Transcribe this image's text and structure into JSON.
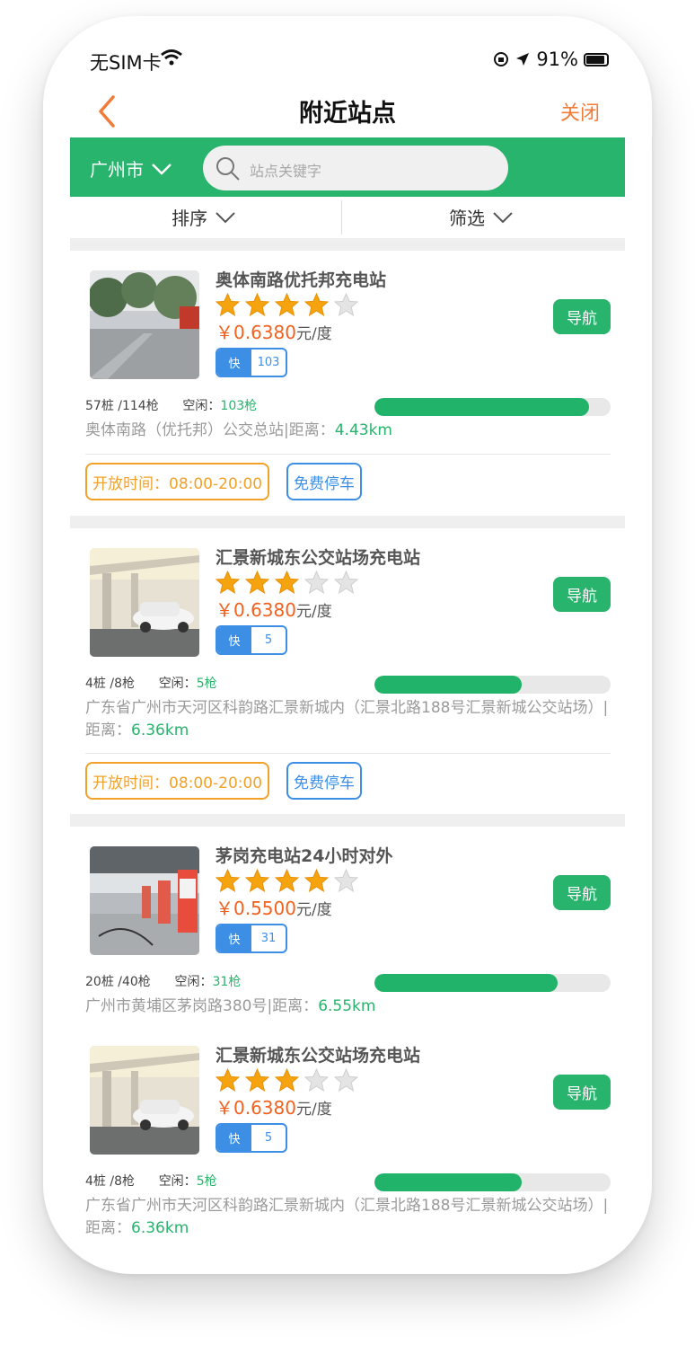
{
  "status_bar": {
    "carrier": "无SIM卡",
    "battery": "91%"
  },
  "nav": {
    "title": "附近站点",
    "close": "关闭"
  },
  "search": {
    "city": "广州市",
    "placeholder": "站点关键字"
  },
  "filters": {
    "sort": "排序",
    "filter": "筛选"
  },
  "colors": {
    "green": "#28b46c",
    "orange": "#f07c3a",
    "blue": "#3d8fe6",
    "price": "#f2611f",
    "star": "#f5a30e"
  },
  "stations": [
    {
      "name": "奥体南路优托邦充电站",
      "rating": 4,
      "price": "￥0.6380",
      "unit": "元/度",
      "tag": "快",
      "tag_count": "103",
      "nav": "导航",
      "piles": "57桩 /114枪",
      "idle_label": "空闲：",
      "idle_value": "103枪",
      "availability": 0.91,
      "address": "奥体南路（优托邦）公交总站|距离：",
      "distance": "4.43km",
      "open_hours": "开放时间：08:00-20:00",
      "parking": "免费停车",
      "image": "bus-station-photo"
    },
    {
      "name": "汇景新城东公交站场充电站",
      "rating": 3,
      "price": "￥0.6380",
      "unit": "元/度",
      "tag": "快",
      "tag_count": "5",
      "nav": "导航",
      "piles": "4桩 /8枪",
      "idle_label": "空闲：",
      "idle_value": "5枪",
      "availability": 0.625,
      "address": "广东省广州市天河区科韵路汇景新城内（汇景北路188号汇景新城公交站场）|距离：",
      "distance": "6.36km",
      "open_hours": "开放时间：08:00-20:00",
      "parking": "免费停车",
      "image": "car-charging-photo"
    },
    {
      "name": "茅岗充电站24小时对外",
      "rating": 4,
      "price": "￥0.5500",
      "unit": "元/度",
      "tag": "快",
      "tag_count": "31",
      "nav": "导航",
      "piles": "20桩 /40枪",
      "idle_label": "空闲：",
      "idle_value": "31枪",
      "availability": 0.775,
      "address": "广州市黄埔区茅岗路380号|距离：",
      "distance": "6.55km",
      "image": "charging-piles-photo"
    },
    {
      "name": "汇景新城东公交站场充电站",
      "rating": 3,
      "price": "￥0.6380",
      "unit": "元/度",
      "tag": "快",
      "tag_count": "5",
      "nav": "导航",
      "piles": "4桩 /8枪",
      "idle_label": "空闲：",
      "idle_value": "5枪",
      "availability": 0.625,
      "address": "广东省广州市天河区科韵路汇景新城内（汇景北路188号汇景新城公交站场）|距离：",
      "distance": "6.36km",
      "image": "car-charging-photo"
    }
  ]
}
